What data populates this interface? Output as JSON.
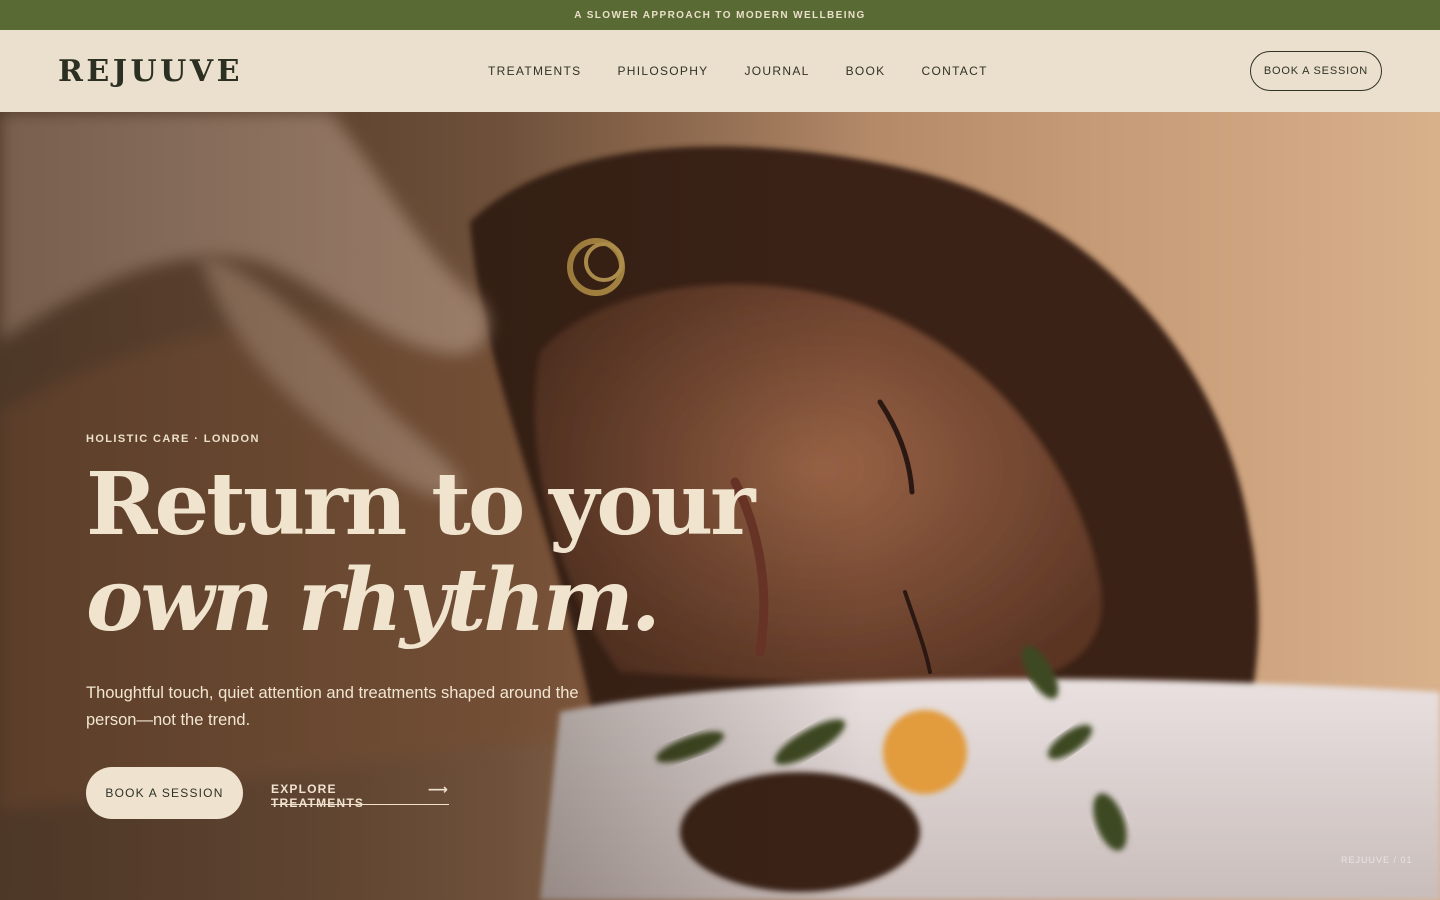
{
  "announcement": "A SLOWER APPROACH TO MODERN WELLBEING",
  "brand": {
    "logo": "REJUUVE"
  },
  "nav": {
    "items": [
      {
        "label": "TREATMENTS"
      },
      {
        "label": "PHILOSOPHY"
      },
      {
        "label": "JOURNAL"
      },
      {
        "label": "BOOK"
      },
      {
        "label": "CONTACT"
      }
    ],
    "cta": "BOOK A SESSION"
  },
  "hero": {
    "eyebrow": "HOLISTIC CARE · LONDON",
    "headline_line1": "Return to your",
    "headline_line2": "own rhythm.",
    "subcopy": "Thoughtful touch, quiet attention and treatments shaped around the person—not the trend.",
    "primary_cta": "BOOK A SESSION",
    "secondary_cta": "EXPLORE TREATMENTS",
    "secondary_icon": "arrow-right-icon",
    "watermark": "REJUUVE / 01"
  },
  "colors": {
    "announcement_bg": "#5a6a34",
    "header_bg": "#ebe0cd",
    "text_dark": "#2f3226",
    "cream": "#efe2ce"
  }
}
